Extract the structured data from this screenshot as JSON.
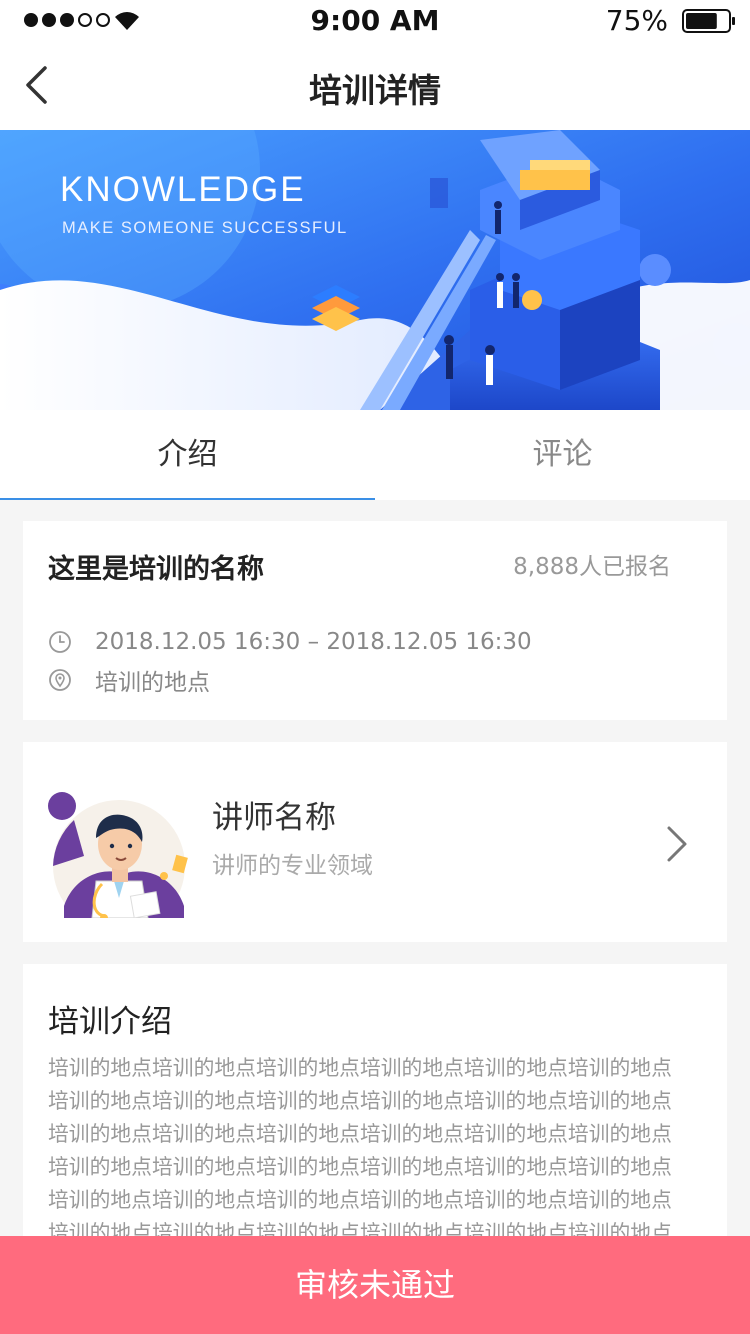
{
  "status_bar": {
    "time": "9:00 AM",
    "battery": "75%",
    "battery_level": 0.75,
    "signal_bars_filled": 3,
    "signal_bars_total": 5
  },
  "nav": {
    "title": "培训详情",
    "back_icon": "chevron-left-icon"
  },
  "banner": {
    "headline": "KNOWLEDGE",
    "subline": "MAKE SOMEONE SUCCESSFUL"
  },
  "tabs": [
    {
      "label": "介绍",
      "active": true
    },
    {
      "label": "评论",
      "active": false
    }
  ],
  "training": {
    "name": "这里是培训的名称",
    "enrolled": "8,888人已报名",
    "time": "2018.12.05  16:30 – 2018.12.05  16:30",
    "location": "培训的地点"
  },
  "teacher": {
    "name": "讲师名称",
    "field": "讲师的专业领域"
  },
  "intro": {
    "title": "培训介绍",
    "body": "培训的地点培训的地点培训的地点培训的地点培训的地点培训的地点培训的地点培训的地点培训的地点培训的地点培训的地点培训的地点培训的地点培训的地点培训的地点培训的地点培训的地点培训的地点培训的地点培训的地点培训的地点培训的地点培训的地点培训的地点培训的地点培训的地点培训的地点培训的地点培训的地点培训的地点培训的地点培训的地点培训的地点培训的地点培训的地点培训的地点"
  },
  "action": {
    "label": "审核未通过"
  },
  "colors": {
    "accent": "#3a8fe6",
    "action": "#ff6b7e",
    "banner_blue": "#2f6ff0"
  }
}
